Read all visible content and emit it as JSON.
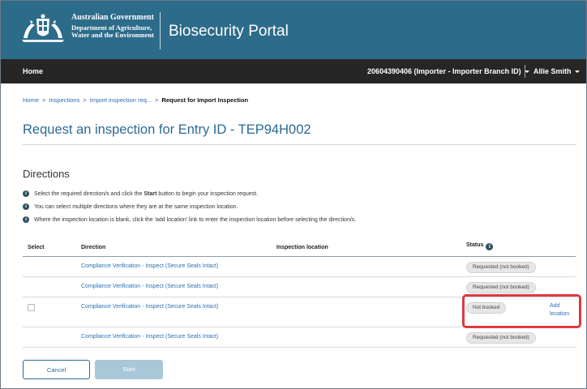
{
  "header": {
    "gov_title": "Australian Government",
    "dept_line1": "Department of Agriculture,",
    "dept_line2": "Water and the Environment",
    "portal_title": "Biosecurity Portal",
    "banner_color": "#2c6b8a"
  },
  "nav": {
    "home": "Home",
    "account": "20604390406 (Importer - Importer Branch ID)",
    "user": "Allie Smith"
  },
  "breadcrumb": {
    "items": [
      "Home",
      "Inspections",
      "Import inspection req..."
    ],
    "separator": ">",
    "current": "Request for Import Inspection"
  },
  "page": {
    "title": "Request an inspection for Entry ID - TEP94H002",
    "title_color": "#2b6a94"
  },
  "directions": {
    "heading": "Directions",
    "items": [
      {
        "before": "Select the required direction/s and click the",
        "bold": "Start",
        "after": "button to begin your inspection request."
      },
      {
        "before": "You can select multiple directions where they are at the same inspection location.",
        "bold": "",
        "after": ""
      },
      {
        "before": "Where the inspection location is blank, click the 'add location' link to enter the inspection location before selecting the direction/s.",
        "bold": "",
        "after": ""
      }
    ]
  },
  "table": {
    "headers": {
      "select": "Select",
      "direction": "Direction",
      "location": "Inspection location",
      "status": "Status"
    },
    "rows": [
      {
        "direction": "Compliance Verification - Inspect (Secure Seals Intact)",
        "status": "Requested (not booked)"
      },
      {
        "direction": "Compliance Verification - Inspect (Secure Seals Intact)",
        "status": "Requested (not booked)"
      },
      {
        "direction": "Compliance Verification - Inspect (Secure Seals Intact)",
        "status": "Not booked",
        "action_line1": "Add",
        "action_line2": "location"
      },
      {
        "direction": "Compliance Verification - Inspect (Secure Seals Intact)",
        "status": "Requested (not booked)"
      }
    ],
    "highlight_color": "#e0393e"
  },
  "buttons": {
    "cancel": "Cancel",
    "start": "Start"
  }
}
